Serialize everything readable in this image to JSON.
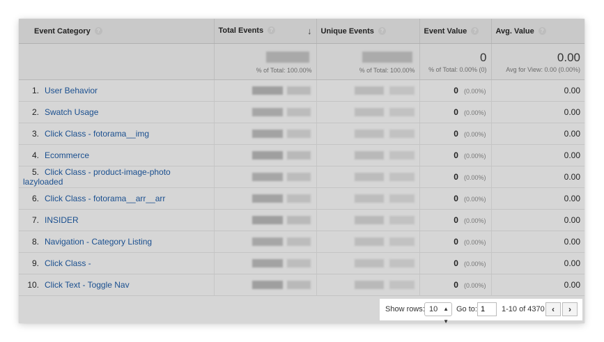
{
  "columns": {
    "event_category": "Event Category",
    "total_events": "Total Events",
    "unique_events": "Unique Events",
    "event_value": "Event Value",
    "avg_value": "Avg. Value"
  },
  "icons": {
    "help": "help-icon",
    "sort": "sort-down-arrow-icon",
    "prev": "chevron-left-icon",
    "next": "chevron-right-icon"
  },
  "totals": {
    "total_events_pct": "% of Total: 100.00%",
    "unique_events_pct": "% of Total: 100.00%",
    "event_value": "0",
    "event_value_pct": "% of Total: 0.00% (0)",
    "avg_value": "0.00",
    "avg_value_note": "Avg for View: 0.00 (0.00%)"
  },
  "rows": [
    {
      "index": "1.",
      "category": "User Behavior",
      "event_value": "0",
      "event_value_pct": "(0.00%)",
      "avg_value": "0.00"
    },
    {
      "index": "2.",
      "category": "Swatch Usage",
      "event_value": "0",
      "event_value_pct": "(0.00%)",
      "avg_value": "0.00"
    },
    {
      "index": "3.",
      "category": "Click Class - fotorama__img",
      "event_value": "0",
      "event_value_pct": "(0.00%)",
      "avg_value": "0.00"
    },
    {
      "index": "4.",
      "category": "Ecommerce",
      "event_value": "0",
      "event_value_pct": "(0.00%)",
      "avg_value": "0.00"
    },
    {
      "index": "5.",
      "category": "Click Class - product-image-photo lazyloaded",
      "event_value": "0",
      "event_value_pct": "(0.00%)",
      "avg_value": "0.00"
    },
    {
      "index": "6.",
      "category": "Click Class - fotorama__arr__arr",
      "event_value": "0",
      "event_value_pct": "(0.00%)",
      "avg_value": "0.00"
    },
    {
      "index": "7.",
      "category": "INSIDER",
      "event_value": "0",
      "event_value_pct": "(0.00%)",
      "avg_value": "0.00"
    },
    {
      "index": "8.",
      "category": "Navigation - Category Listing",
      "event_value": "0",
      "event_value_pct": "(0.00%)",
      "avg_value": "0.00"
    },
    {
      "index": "9.",
      "category": "Click Class -",
      "event_value": "0",
      "event_value_pct": "(0.00%)",
      "avg_value": "0.00"
    },
    {
      "index": "10.",
      "category": "Click Text - Toggle Nav",
      "event_value": "0",
      "event_value_pct": "(0.00%)",
      "avg_value": "0.00"
    }
  ],
  "pagination": {
    "show_rows_label": "Show rows:",
    "rows_value": "10",
    "goto_label": "Go to:",
    "goto_value": "1",
    "range_text": "1-10 of 4370",
    "prev_glyph": "‹",
    "next_glyph": "›"
  }
}
